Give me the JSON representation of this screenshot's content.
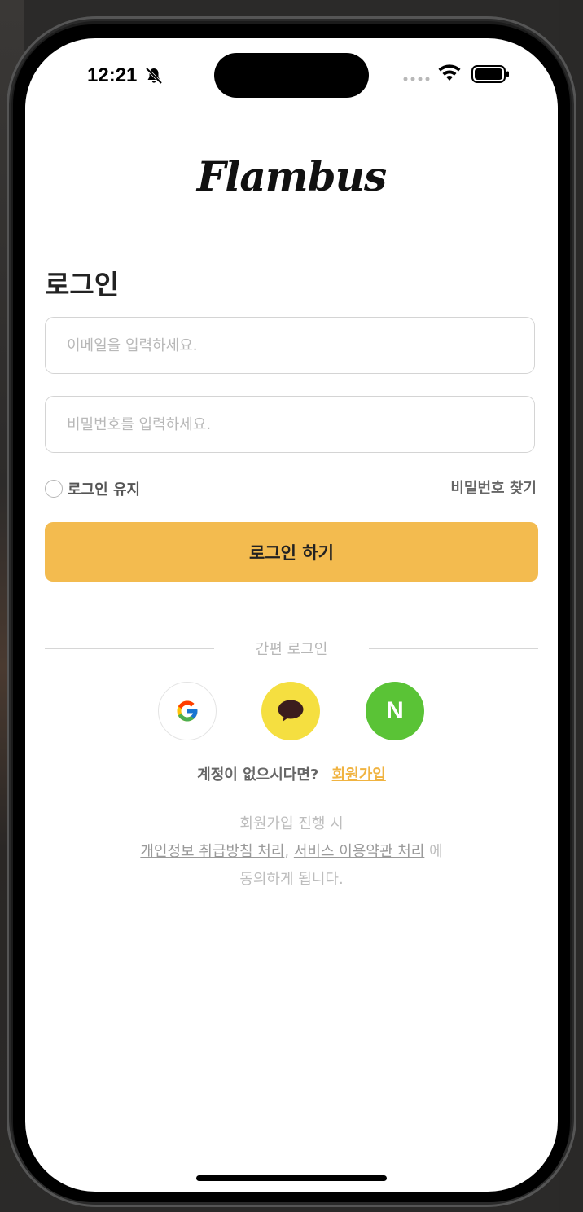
{
  "status_bar": {
    "time": "12:21"
  },
  "app": {
    "logo_text": "Flambus"
  },
  "login": {
    "title": "로그인",
    "email_placeholder": "이메일을 입력하세요.",
    "password_placeholder": "비밀번호를 입력하세요.",
    "keep_logged_in_label": "로그인 유지",
    "find_password_label": "비밀번호 찾기",
    "submit_label": "로그인 하기"
  },
  "social_login": {
    "divider_label": "간편 로그인",
    "providers": [
      "google",
      "kakao",
      "naver"
    ],
    "naver_letter": "N",
    "colors": {
      "kakao": "#f5df40",
      "naver": "#5ac336"
    }
  },
  "signup": {
    "prompt": "계정이 없으시다면?",
    "link_label": "회원가입"
  },
  "terms": {
    "line1": "회원가입 진행 시",
    "privacy_link": "개인정보 취급방침 처리",
    "separator": ",",
    "service_link": "서비스 이용약관 처리",
    "suffix": " 에",
    "line3": "동의하게 됩니다."
  },
  "theme": {
    "accent": "#f3bb4f"
  }
}
